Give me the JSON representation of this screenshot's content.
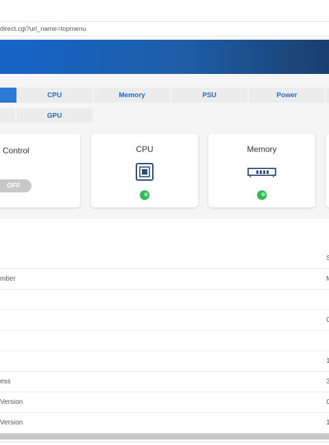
{
  "browser": {
    "url": "direct.cgi?url_name=topmenu"
  },
  "tabs": {
    "row1": [
      {
        "label": "",
        "active": true
      },
      {
        "label": "CPU",
        "active": false
      },
      {
        "label": "Memory",
        "active": false
      },
      {
        "label": "PSU",
        "active": false
      },
      {
        "label": "Power",
        "active": false
      },
      {
        "label": "",
        "active": false
      }
    ],
    "row2": [
      {
        "label": "",
        "active": false
      },
      {
        "label": "GPU",
        "active": false
      }
    ]
  },
  "cards": {
    "control": {
      "title": "D Control",
      "toggle_label": "OFF"
    },
    "cpu": {
      "title": "CPU",
      "icon": "cpu-chip-icon",
      "status": "ok"
    },
    "memory": {
      "title": "Memory",
      "icon": "memory-module-icon",
      "status": "ok"
    }
  },
  "colors": {
    "accent": "#2a7ad6",
    "tab_text": "#2a6ac0",
    "status_ok": "#2fbb4f",
    "icon": "#2a4d7a"
  },
  "info_table": {
    "rows": [
      {
        "label": "",
        "value": "S"
      },
      {
        "label": "mber",
        "value": "M"
      },
      {
        "label": "",
        "value": ""
      },
      {
        "label": "",
        "value": "C"
      },
      {
        "label": "",
        "value": ""
      },
      {
        "label": "",
        "value": "1"
      },
      {
        "label": "ess",
        "value": "3"
      },
      {
        "label": "Version",
        "value": "C"
      },
      {
        "label": "Version",
        "value": "1"
      }
    ]
  }
}
